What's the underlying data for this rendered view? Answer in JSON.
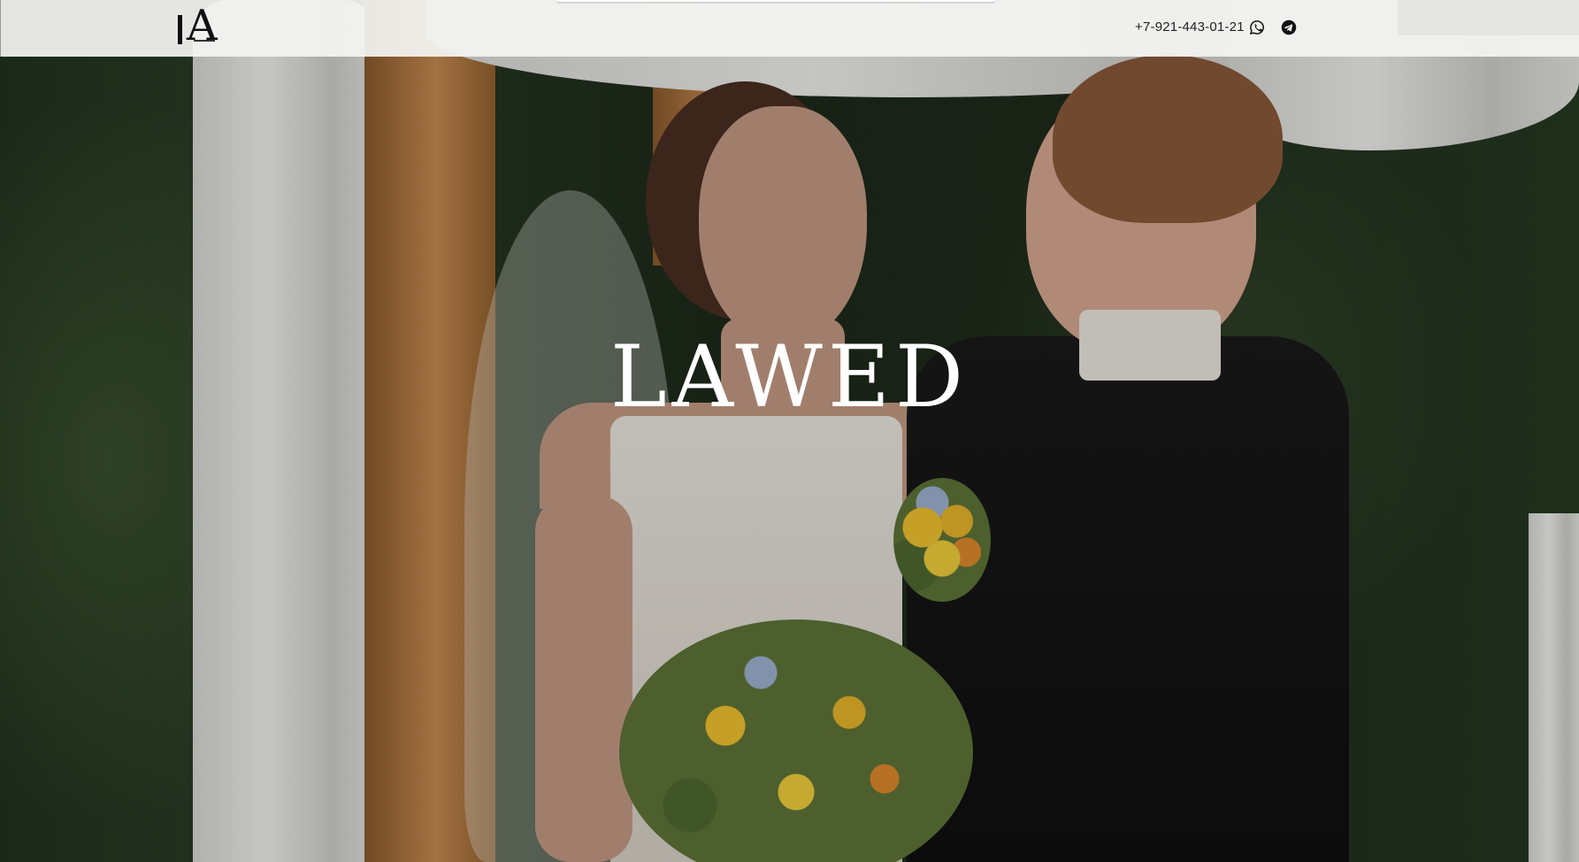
{
  "header": {
    "logo_text": "LA",
    "phone": "+7-921-443-01-21",
    "icons": [
      "whatsapp-icon",
      "telegram-icon"
    ]
  },
  "hero": {
    "headline": "LAWED"
  },
  "colors": {
    "header_bg": "#f4f4f2",
    "headline": "#ffffff",
    "text_dark": "#222222"
  }
}
